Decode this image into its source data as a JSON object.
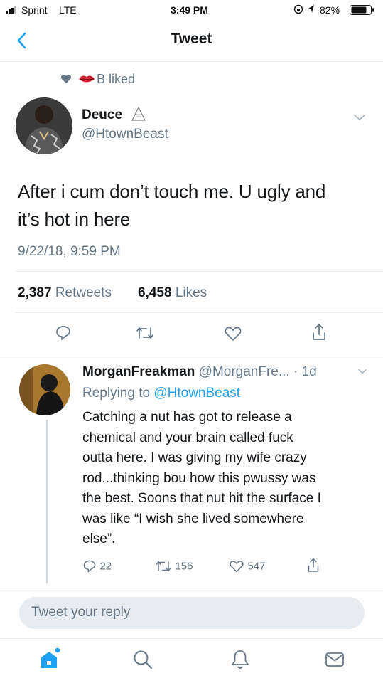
{
  "status_bar": {
    "carrier": "Sprint",
    "network": "LTE",
    "time": "3:49 PM",
    "battery": "82%"
  },
  "nav": {
    "back_icon": "chevron-left-icon",
    "title": "Tweet"
  },
  "social_context": {
    "text": "B liked"
  },
  "tweet": {
    "display_name": "Deuce",
    "handle": "@HtownBeast",
    "text_line1": "After i cum don’t touch me. U ugly and",
    "text_line2": "it’s hot in here",
    "timestamp": "9/22/18, 9:59 PM",
    "retweets_count": "2,387",
    "retweets_label": "Retweets",
    "likes_count": "6,458",
    "likes_label": "Likes"
  },
  "reply": {
    "display_name": "MorganFreakman",
    "handle_trunc": "@MorganFre...",
    "time": "· 1d",
    "replying_to_label": "Replying to",
    "replying_to_handle": "@HtownBeast",
    "lines": [
      "Catching a nut has got to release a",
      "chemical and your brain called fuck",
      "outta here. I was giving my wife crazy",
      "rod...thinking bou how this pwussy was",
      "the best. Soons that nut hit the surface I",
      "was like “I wish she lived somewhere",
      "else”."
    ],
    "reply_count": "22",
    "retweet_count": "156",
    "like_count": "547"
  },
  "compose": {
    "placeholder": "Tweet your reply"
  },
  "tabbar": {
    "items": [
      "home-icon",
      "search-icon",
      "notifications-icon",
      "messages-icon"
    ]
  },
  "colors": {
    "accent": "#1da1f2",
    "secondary": "#657786",
    "divider": "#e6ecf0"
  }
}
